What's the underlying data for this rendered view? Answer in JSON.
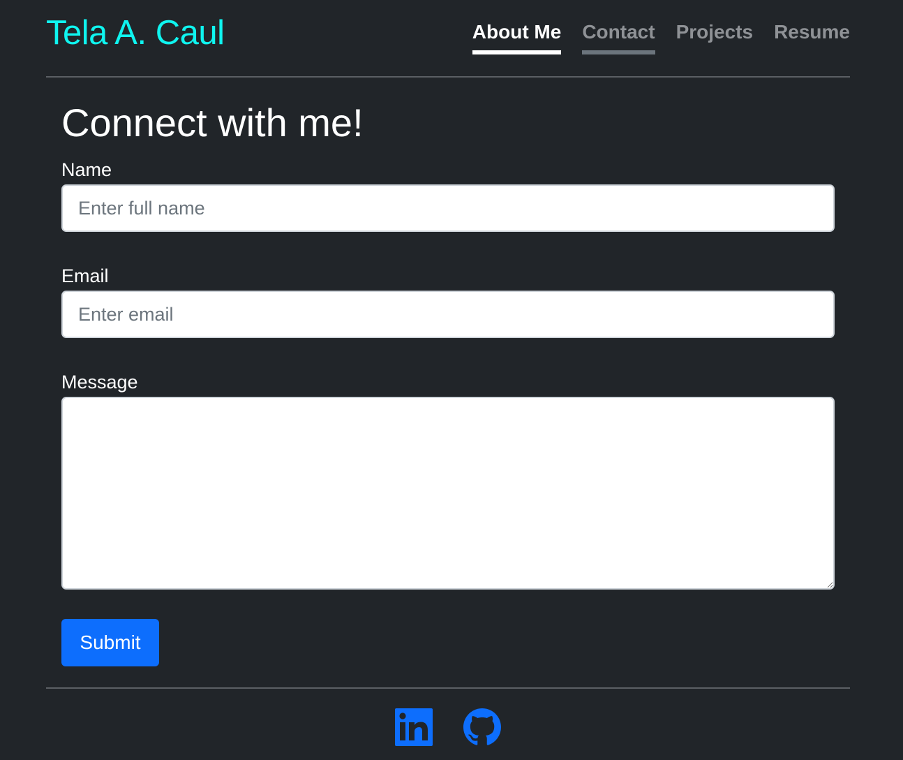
{
  "header": {
    "brand": "Tela A. Caul",
    "nav": [
      {
        "label": "About Me",
        "state": "active"
      },
      {
        "label": "Contact",
        "state": "hover"
      },
      {
        "label": "Projects",
        "state": "normal"
      },
      {
        "label": "Resume",
        "state": "normal"
      }
    ]
  },
  "main": {
    "title": "Connect with me!",
    "name": {
      "label": "Name",
      "placeholder": "Enter full name",
      "value": ""
    },
    "email": {
      "label": "Email",
      "placeholder": "Enter email",
      "value": ""
    },
    "message": {
      "label": "Message",
      "value": ""
    },
    "submit_label": "Submit"
  },
  "footer": {
    "links": [
      {
        "icon": "linkedin-icon"
      },
      {
        "icon": "github-icon"
      }
    ]
  },
  "colors": {
    "background": "#212529",
    "brand": "#0ff5f0",
    "primary": "#0d6efd",
    "nav_inactive": "#8f9296"
  }
}
